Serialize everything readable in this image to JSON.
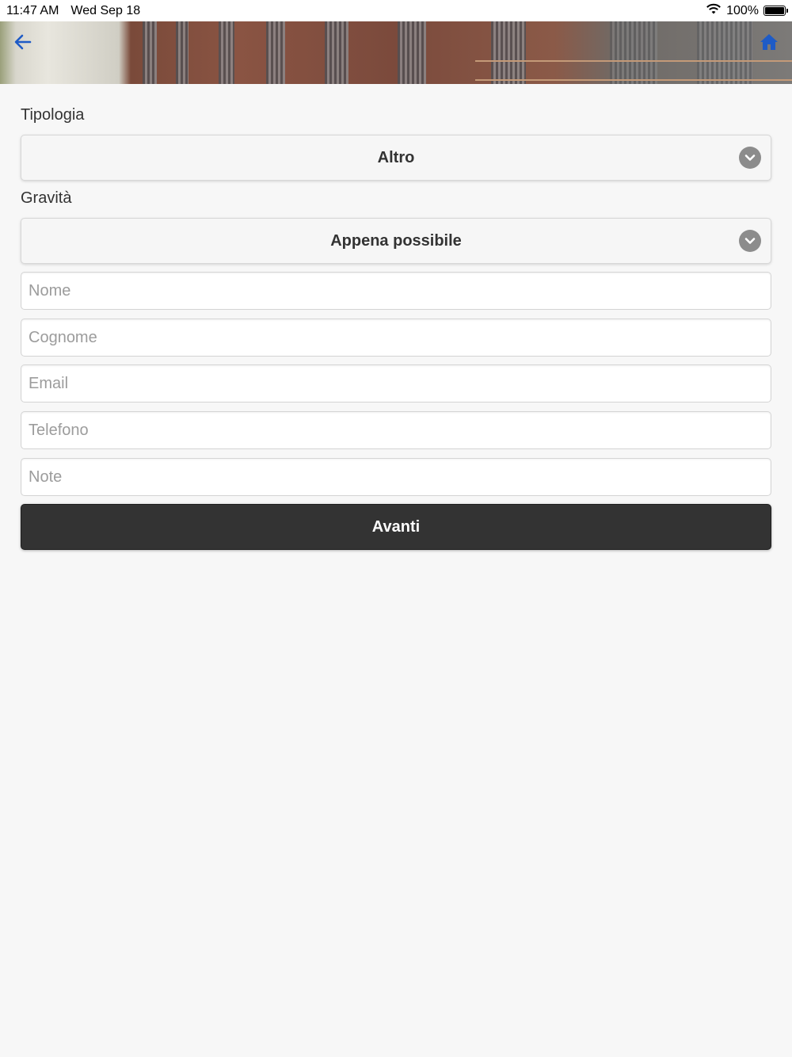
{
  "status_bar": {
    "time": "11:47 AM",
    "date": "Wed Sep 18",
    "battery_percent": "100%",
    "battery_level": 1.0
  },
  "header": {
    "back_icon": "arrow-left-icon",
    "home_icon": "home-icon",
    "icon_color": "#1e5bc6"
  },
  "form": {
    "tipologia_label": "Tipologia",
    "tipologia_value": "Altro",
    "gravita_label": "Gravità",
    "gravita_value": "Appena possibile",
    "nome_placeholder": "Nome",
    "cognome_placeholder": "Cognome",
    "email_placeholder": "Email",
    "telefono_placeholder": "Telefono",
    "note_placeholder": "Note",
    "submit_label": "Avanti"
  }
}
